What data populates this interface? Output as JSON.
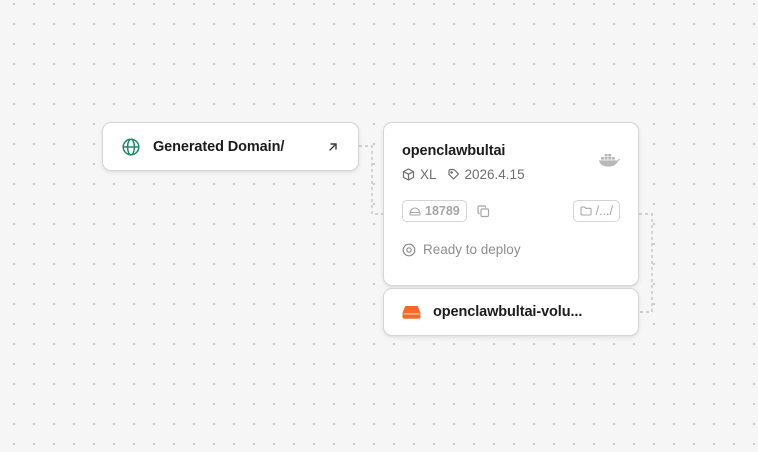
{
  "domain_node": {
    "label": "Generated Domain/",
    "icon": "globe-icon",
    "action_icon": "arrow-up-right-icon",
    "icon_color": "#1f8a68"
  },
  "service_node": {
    "title": "openclawbultai",
    "source_icon": "docker-icon",
    "size": "XL",
    "version": "2026.4.15",
    "port": "18789",
    "path": "/.../",
    "status": "Ready to deploy"
  },
  "volume_node": {
    "label": "openclawbultai-volu...",
    "icon": "hard-drive-icon",
    "icon_color": "#f26b2b"
  }
}
